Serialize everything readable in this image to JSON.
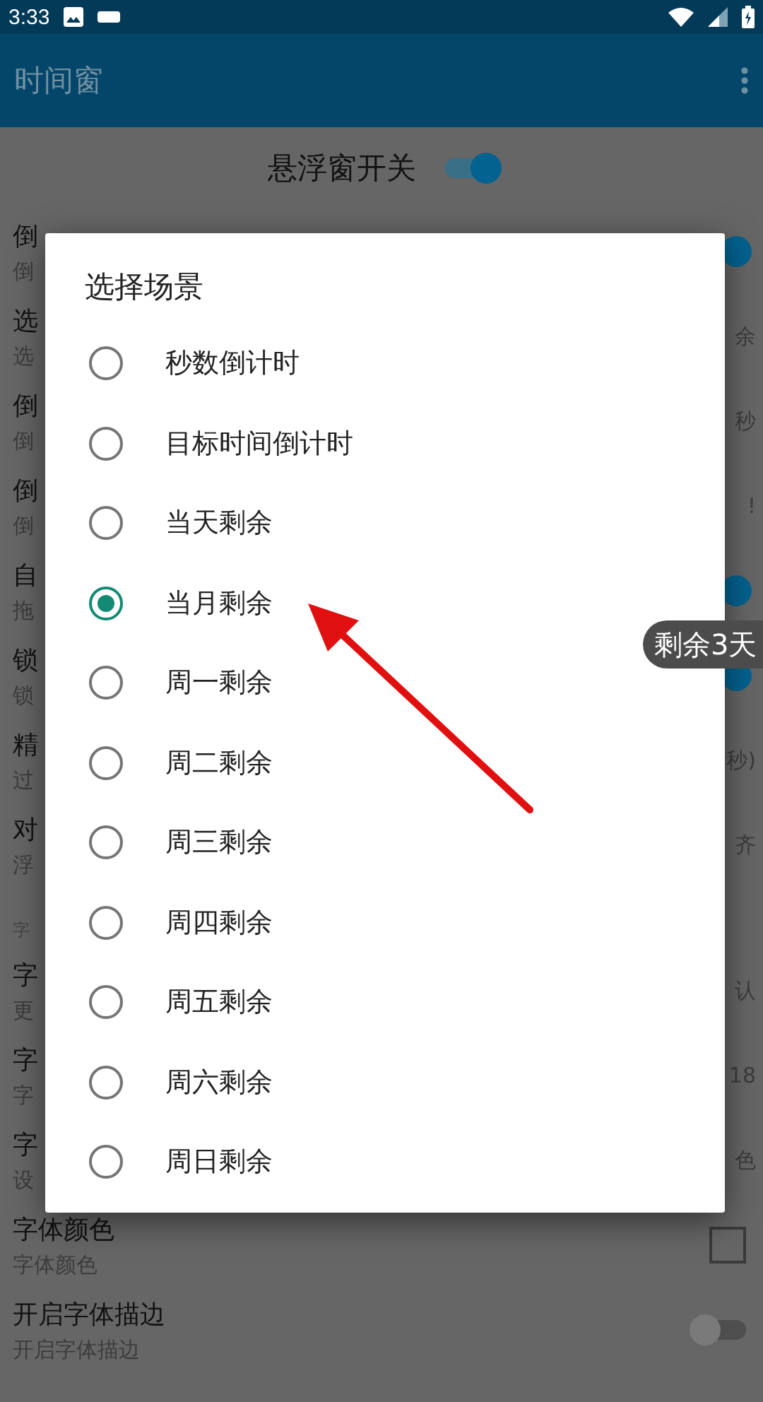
{
  "status_bar": {
    "time": "3:33"
  },
  "app_bar": {
    "title": "时间窗"
  },
  "master_switch": {
    "label": "悬浮窗开关",
    "on": true
  },
  "settings": [
    {
      "kind": "row",
      "title": "倒",
      "subtitle": "倒",
      "trailing": {
        "kind": "switch",
        "on": true
      }
    },
    {
      "kind": "row",
      "title": "选",
      "subtitle": "选",
      "trailing": {
        "kind": "text",
        "text": "余"
      }
    },
    {
      "kind": "row",
      "title": "倒",
      "subtitle": "倒",
      "trailing": {
        "kind": "text",
        "text": "秒"
      }
    },
    {
      "kind": "row",
      "title": "倒",
      "subtitle": "倒",
      "trailing": {
        "kind": "text",
        "text": "!"
      }
    },
    {
      "kind": "row",
      "title": "自",
      "subtitle": "拖",
      "trailing": {
        "kind": "switch",
        "on": true
      }
    },
    {
      "kind": "row",
      "title": "锁",
      "subtitle": "锁",
      "trailing": {
        "kind": "switch",
        "on": true
      }
    },
    {
      "kind": "row",
      "title": "精",
      "subtitle": "过",
      "trailing": {
        "kind": "text",
        "text": "秒)"
      }
    },
    {
      "kind": "row",
      "title": "对",
      "subtitle": "浮",
      "trailing": {
        "kind": "text",
        "text": "齐"
      }
    },
    {
      "kind": "header",
      "title": "字"
    },
    {
      "kind": "row",
      "title": "字",
      "subtitle": "更",
      "trailing": {
        "kind": "text",
        "text": "认"
      }
    },
    {
      "kind": "row",
      "title": "字",
      "subtitle": "字",
      "trailing": {
        "kind": "text",
        "text": "18"
      }
    },
    {
      "kind": "row",
      "title": "字",
      "subtitle": "设",
      "trailing": {
        "kind": "text",
        "text": "色"
      }
    },
    {
      "kind": "row",
      "title": "字体颜色",
      "subtitle": "字体颜色",
      "trailing": {
        "kind": "swatch"
      }
    },
    {
      "kind": "row",
      "title": "开启字体描边",
      "subtitle": "开启字体描边",
      "trailing": {
        "kind": "switch",
        "on": false
      }
    }
  ],
  "floating_window": {
    "text": "剩余3天"
  },
  "dialog": {
    "title": "选择场景",
    "options": [
      {
        "label": "秒数倒计时",
        "selected": false
      },
      {
        "label": "目标时间倒计时",
        "selected": false
      },
      {
        "label": "当天剩余",
        "selected": false
      },
      {
        "label": "当月剩余",
        "selected": true
      },
      {
        "label": "周一剩余",
        "selected": false
      },
      {
        "label": "周二剩余",
        "selected": false
      },
      {
        "label": "周三剩余",
        "selected": false
      },
      {
        "label": "周四剩余",
        "selected": false
      },
      {
        "label": "周五剩余",
        "selected": false
      },
      {
        "label": "周六剩余",
        "selected": false
      },
      {
        "label": "周日剩余",
        "selected": false
      }
    ]
  }
}
